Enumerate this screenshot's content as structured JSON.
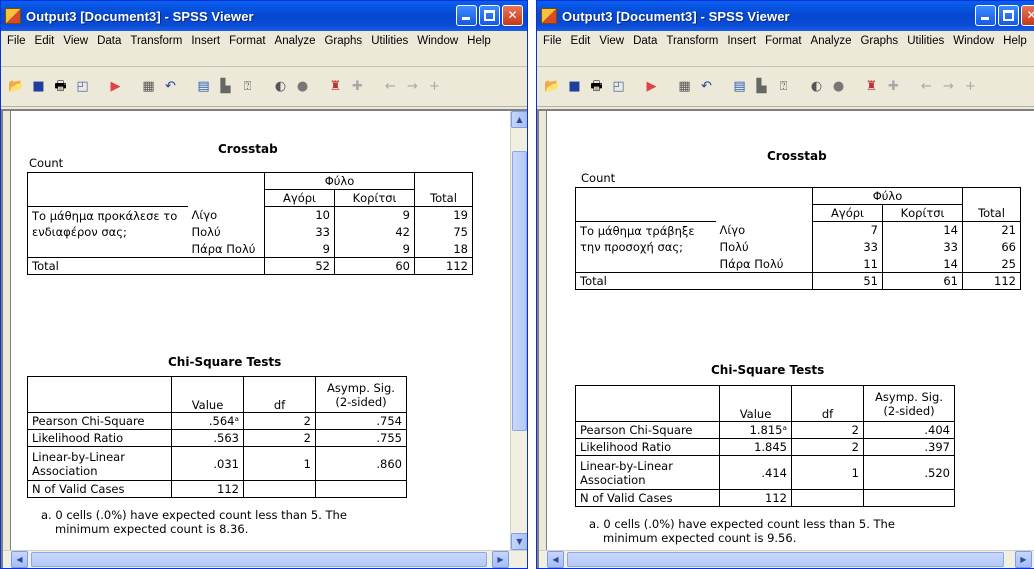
{
  "windows": [
    {
      "title": "Output3 [Document3] - SPSS Viewer",
      "menu": [
        "File",
        "Edit",
        "View",
        "Data",
        "Transform",
        "Insert",
        "Format",
        "Analyze",
        "Graphs",
        "Utilities",
        "Window",
        "Help"
      ],
      "crosstab": {
        "title": "Crosstab",
        "count_label": "Count",
        "group_header": "Φύλο",
        "col_headers": [
          "Αγόρι",
          "Κορίτσι",
          "Total"
        ],
        "row_var": "Το μάθημα προκάλεσε το ενδιαφέρον σας;",
        "rows": [
          {
            "label": "Λίγο",
            "values": [
              "10",
              "9",
              "19"
            ]
          },
          {
            "label": "Πολύ",
            "values": [
              "33",
              "42",
              "75"
            ]
          },
          {
            "label": "Πάρα Πολύ",
            "values": [
              "9",
              "9",
              "18"
            ]
          }
        ],
        "total_label": "Total",
        "totals": [
          "52",
          "60",
          "112"
        ]
      },
      "chi": {
        "title": "Chi-Square Tests",
        "headers": [
          "Value",
          "df",
          "Asymp. Sig. (2-sided)"
        ],
        "rows": [
          {
            "label": "Pearson Chi-Square",
            "value": ".564ᵃ",
            "df": "2",
            "sig": ".754"
          },
          {
            "label": "Likelihood Ratio",
            "value": ".563",
            "df": "2",
            "sig": ".755"
          },
          {
            "label": "Linear-by-Linear Association",
            "value": ".031",
            "df": "1",
            "sig": ".860"
          },
          {
            "label": "N of Valid Cases",
            "value": "112",
            "df": "",
            "sig": ""
          }
        ],
        "footnote_line1": "a. 0 cells (.0%) have expected count less than 5. The",
        "footnote_line2": "minimum expected count is 8.36."
      }
    },
    {
      "title": "Output3 [Document3] - SPSS Viewer",
      "menu": [
        "File",
        "Edit",
        "View",
        "Data",
        "Transform",
        "Insert",
        "Format",
        "Analyze",
        "Graphs",
        "Utilities",
        "Window",
        "Help"
      ],
      "crosstab": {
        "title": "Crosstab",
        "count_label": "Count",
        "group_header": "Φύλο",
        "col_headers": [
          "Αγόρι",
          "Κορίτσι",
          "Total"
        ],
        "row_var": "Το μάθημα τράβηξε την προσοχή σας;",
        "rows": [
          {
            "label": "Λίγο",
            "values": [
              "7",
              "14",
              "21"
            ]
          },
          {
            "label": "Πολύ",
            "values": [
              "33",
              "33",
              "66"
            ]
          },
          {
            "label": "Πάρα Πολύ",
            "values": [
              "11",
              "14",
              "25"
            ]
          }
        ],
        "total_label": "Total",
        "totals": [
          "51",
          "61",
          "112"
        ]
      },
      "chi": {
        "title": "Chi-Square Tests",
        "headers": [
          "Value",
          "df",
          "Asymp. Sig. (2-sided)"
        ],
        "rows": [
          {
            "label": "Pearson Chi-Square",
            "value": "1.815ᵃ",
            "df": "2",
            "sig": ".404"
          },
          {
            "label": "Likelihood Ratio",
            "value": "1.845",
            "df": "2",
            "sig": ".397"
          },
          {
            "label": "Linear-by-Linear Association",
            "value": ".414",
            "df": "1",
            "sig": ".520"
          },
          {
            "label": "N of Valid Cases",
            "value": "112",
            "df": "",
            "sig": ""
          }
        ],
        "footnote_line1": "a. 0 cells (.0%) have expected count less than 5. The",
        "footnote_line2": "minimum expected count is 9.56."
      }
    }
  ]
}
